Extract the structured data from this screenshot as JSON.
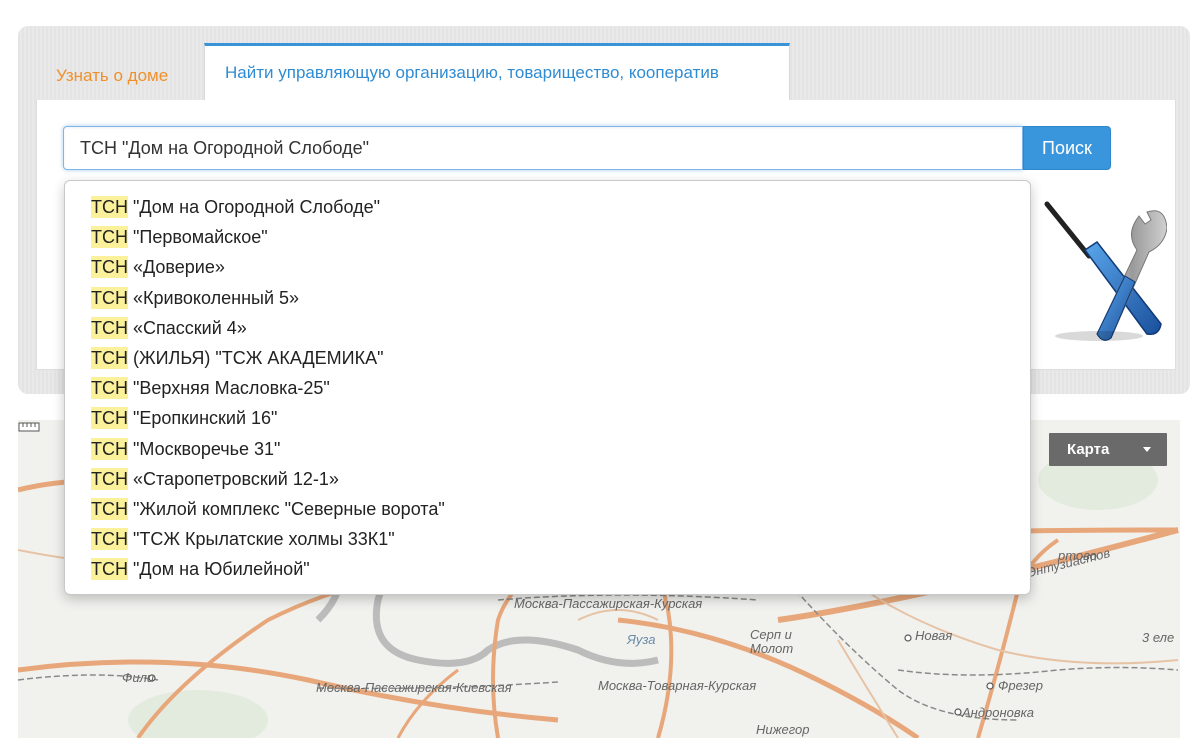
{
  "tabs": [
    {
      "label": "Узнать о доме",
      "active": false
    },
    {
      "label": "Найти управляющую организацию, товарищество, кооператив",
      "active": true
    }
  ],
  "search": {
    "value": "ТСН \"Дом на Огородной Слободе\"",
    "button_label": "Поиск"
  },
  "suggestions": {
    "highlight": "ТСН",
    "items": [
      {
        "highlight": "ТСН",
        "rest": " \"Дом на Огородной Слободе\""
      },
      {
        "highlight": "ТСН",
        "rest": " \"Первомайское\""
      },
      {
        "highlight": "ТСН",
        "rest": " «Доверие»"
      },
      {
        "highlight": "ТСН",
        "rest": " «Кривоколенный 5»"
      },
      {
        "highlight": "ТСН",
        "rest": " «Спасский 4»"
      },
      {
        "highlight": "ТСН",
        "rest": " (ЖИЛЬЯ) \"ТСЖ АКАДЕМИКА\""
      },
      {
        "highlight": "ТСН",
        "rest": " \"Верхняя Масловка-25\""
      },
      {
        "highlight": "ТСН",
        "rest": " \"Еропкинский 16\""
      },
      {
        "highlight": "ТСН",
        "rest": " \"Москворечье 31\""
      },
      {
        "highlight": "ТСН",
        "rest": " «Старопетровский 12-1»"
      },
      {
        "highlight": "ТСН",
        "rest": " \"Жилой комплекс \"Северные ворота\""
      },
      {
        "highlight": "ТСН",
        "rest": " \"ТСЖ Крылатские холмы 33К1\""
      },
      {
        "highlight": "ТСН",
        "rest": " \"Дом на Юбилейной\""
      }
    ]
  },
  "map": {
    "type_label": "Карта",
    "labels": {
      "kursk_rail": "Москва-Пассажирская-Курская",
      "kiev_rail": "Москва-Пассажирская-Киевская",
      "kursk_freight": "Москва-Товарная-Курская",
      "serp_molot": "Серп и Молот",
      "yauza": "Яуза",
      "novaya": "Новая",
      "frezer": "Фрезер",
      "andronovka": "Андроновка",
      "fili": "Фили",
      "nizhegor": "Нижегор",
      "entuziastov": "ш. Энтузиастов",
      "perovo": "ртово",
      "zeleny": "3 еле"
    }
  },
  "colors": {
    "accent": "#3a96dc",
    "tab_inactive": "#f0902a",
    "highlight": "#fbf19a",
    "road_major": "#e8a77a",
    "river": "#b3b3b3"
  },
  "icons": [
    "wrench-screwdriver-icon",
    "ruler-icon",
    "caret-down-icon"
  ]
}
